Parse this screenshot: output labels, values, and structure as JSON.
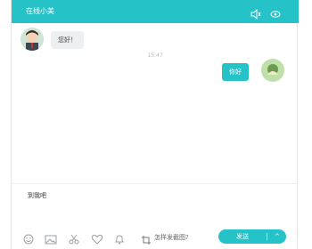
{
  "header": {
    "title": "在线小美"
  },
  "messages": [
    {
      "side": "left",
      "text": "您好！"
    },
    {
      "side": "right",
      "text": "你好"
    }
  ],
  "timestamp": "15:47",
  "composer": {
    "value": "到我吧"
  },
  "toolbar": {
    "icons": [
      "emoji-icon",
      "image-icon",
      "scissors-icon",
      "heart-icon",
      "bell-icon"
    ],
    "screenshot_label": "怎样发截图?"
  },
  "send": {
    "label": "发送",
    "more": "^"
  },
  "colors": {
    "accent": "#25c2c8"
  }
}
